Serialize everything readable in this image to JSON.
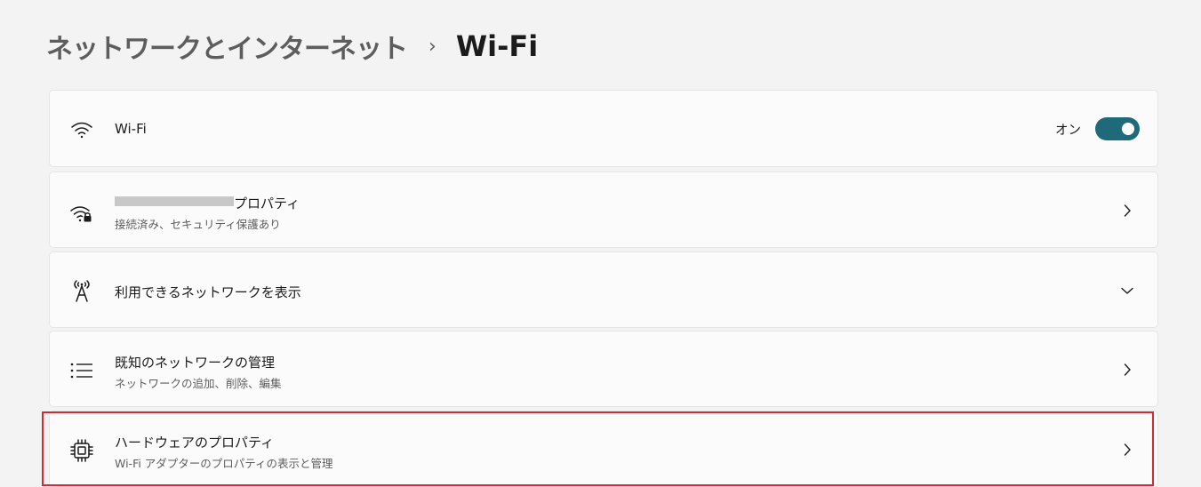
{
  "breadcrumb": {
    "parent": "ネットワークとインターネット",
    "separator": "›",
    "current": "Wi-Fi"
  },
  "wifi_toggle": {
    "title": "Wi-Fi",
    "state_label": "オン",
    "on": true,
    "icon": "wifi-icon"
  },
  "network_properties": {
    "title_suffix": "プロパティ",
    "subtitle": "接続済み、セキュリティ保護あり",
    "icon": "wifi-lock-icon"
  },
  "available_networks": {
    "title": "利用できるネットワークを表示",
    "icon": "antenna-icon"
  },
  "known_networks": {
    "title": "既知のネットワークの管理",
    "subtitle": "ネットワークの追加、削除、編集",
    "icon": "list-icon"
  },
  "hardware_properties": {
    "title": "ハードウェアのプロパティ",
    "subtitle": "Wi-Fi アダプターのプロパティの表示と管理",
    "icon": "chip-icon"
  },
  "colors": {
    "accent": "#1e6a7a",
    "highlight": "#d42a33",
    "background": "#f3f3f3",
    "card": "#fbfbfb"
  }
}
